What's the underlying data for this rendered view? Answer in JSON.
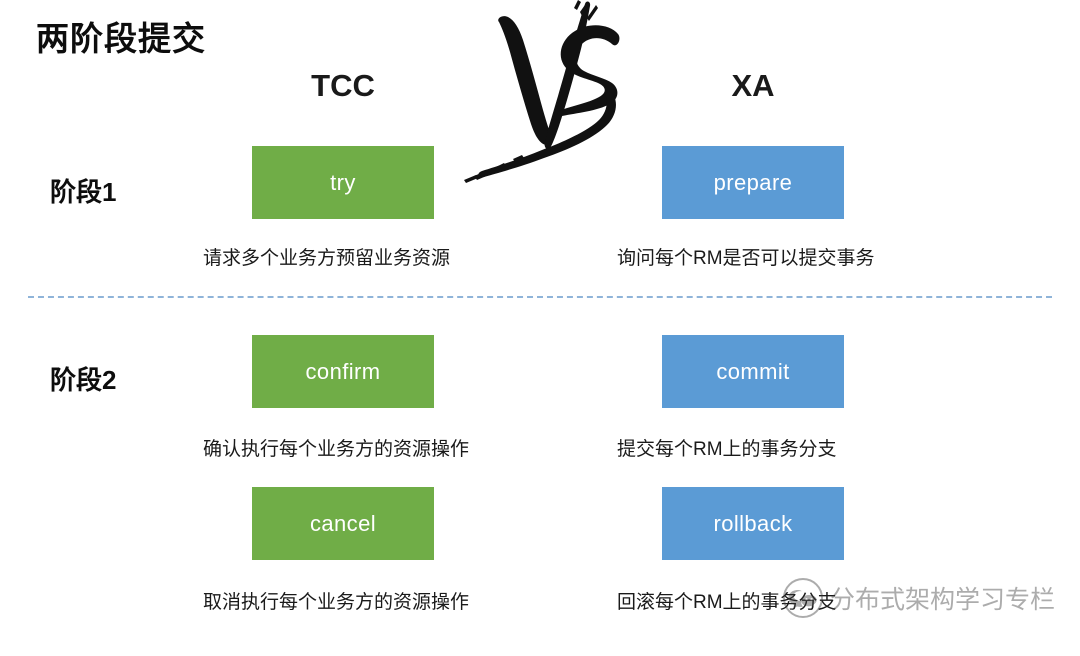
{
  "slide": {
    "title": "两阶段提交",
    "background_color": "#ffffff"
  },
  "columns": {
    "left": {
      "header": "TCC",
      "accent_color": "#70ad47"
    },
    "right": {
      "header": "XA",
      "accent_color": "#5b9bd5"
    }
  },
  "versus": {
    "logo_label": "VS",
    "icon": "vs-brush-icon"
  },
  "stages": [
    {
      "label": "阶段1",
      "rows": [
        {
          "left": {
            "box_label": "try",
            "caption": "请求多个业务方预留业务资源"
          },
          "right": {
            "box_label": "prepare",
            "caption": "询问每个RM是否可以提交事务"
          }
        }
      ]
    },
    {
      "label": "阶段2",
      "rows": [
        {
          "left": {
            "box_label": "confirm",
            "caption": "确认执行每个业务方的资源操作"
          },
          "right": {
            "box_label": "commit",
            "caption": "提交每个RM上的事务分支"
          }
        },
        {
          "left": {
            "box_label": "cancel",
            "caption": "取消执行每个业务方的资源操作"
          },
          "right": {
            "box_label": "rollback",
            "caption": "回滚每个RM上的事务分支"
          }
        }
      ]
    }
  ],
  "divider": {
    "style": "dashed",
    "color": "#8fb4d9"
  },
  "watermark": {
    "text": "分布式架构学习专栏",
    "icon": "wechat-official-account-icon"
  }
}
